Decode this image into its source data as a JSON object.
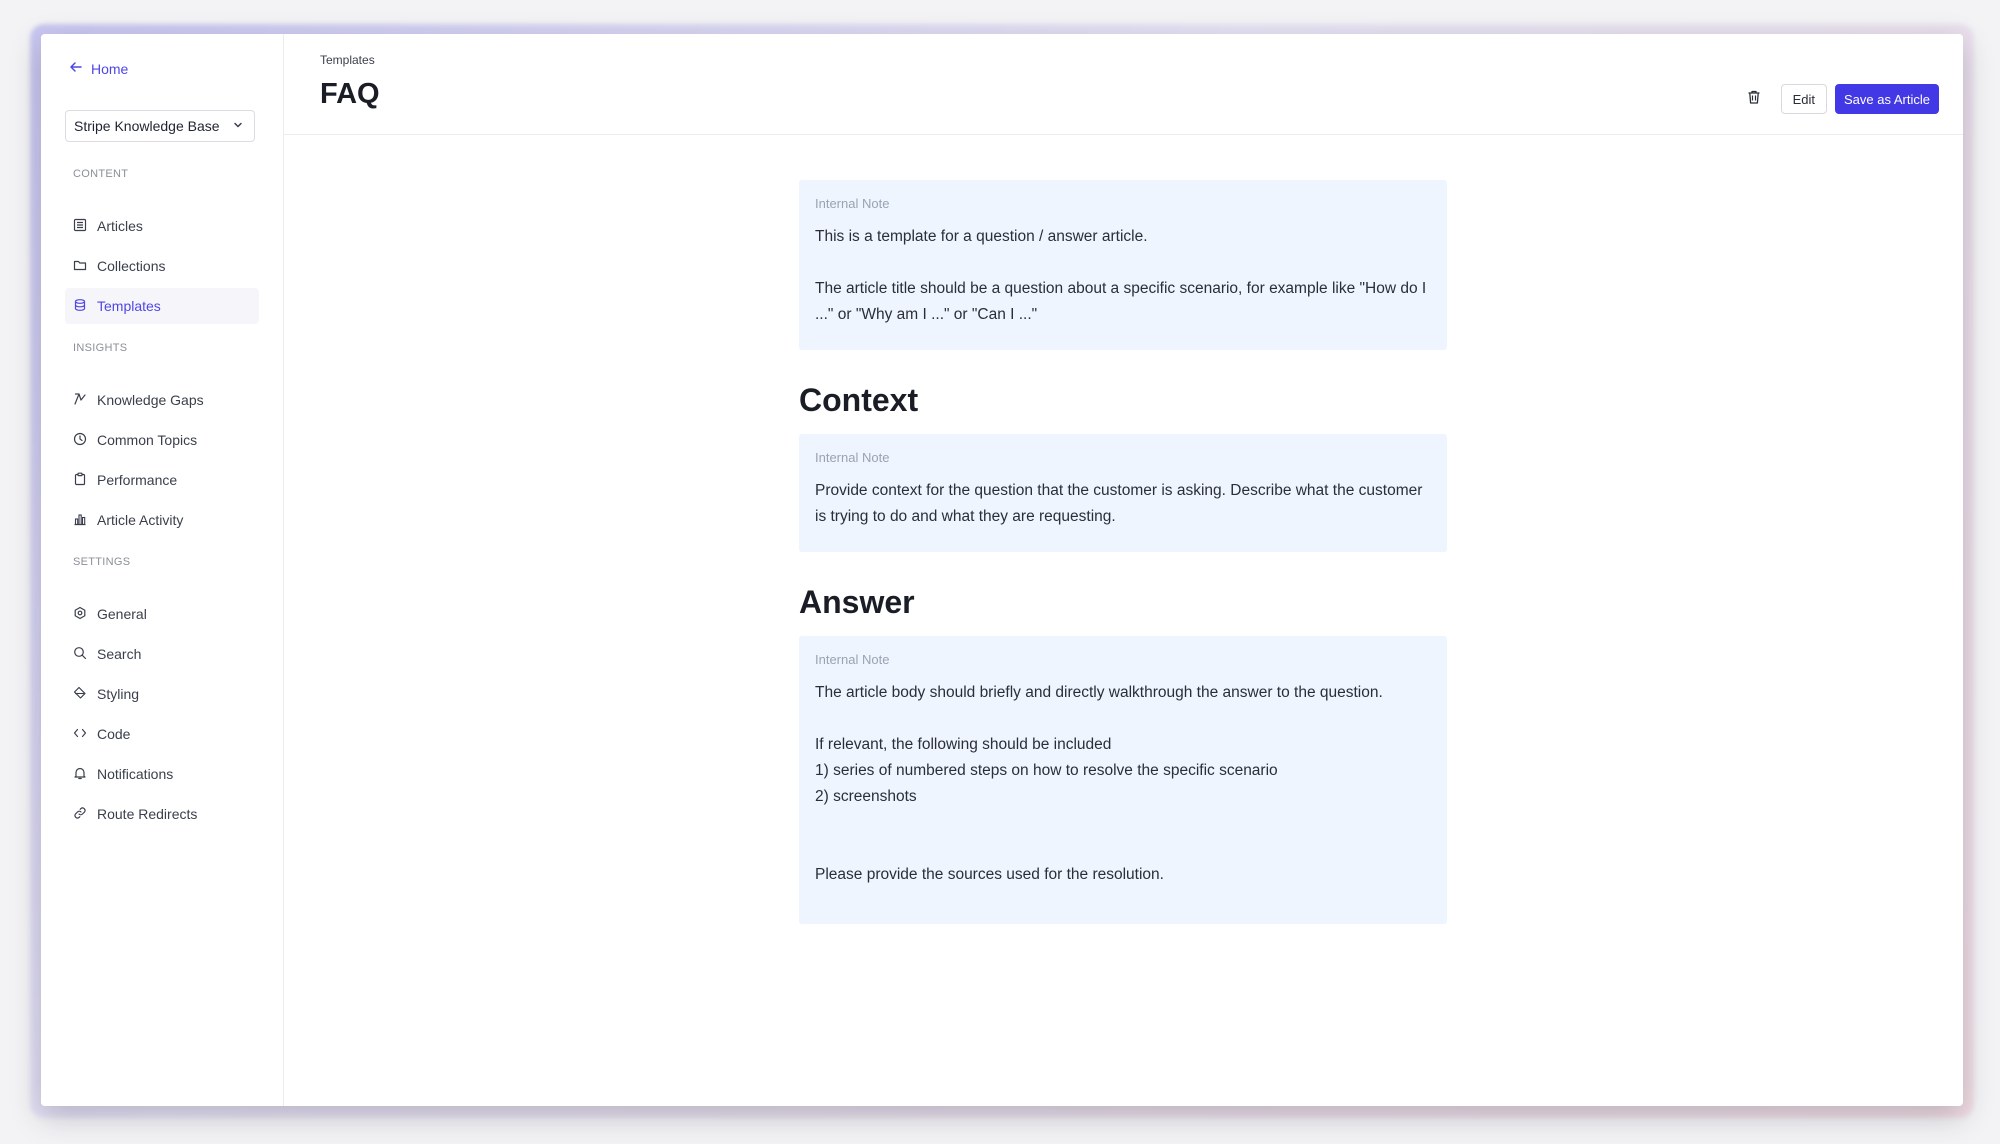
{
  "sidebar": {
    "home_label": "Home",
    "kb_select": "Stripe Knowledge Base",
    "sections": {
      "content": "CONTENT",
      "insights": "INSIGHTS",
      "settings": "SETTINGS"
    },
    "content_items": [
      {
        "label": "Articles",
        "icon": "articles-icon"
      },
      {
        "label": "Collections",
        "icon": "folder-icon"
      },
      {
        "label": "Templates",
        "icon": "database-icon",
        "active": true
      }
    ],
    "insights_items": [
      {
        "label": "Knowledge Gaps",
        "icon": "gap-icon"
      },
      {
        "label": "Common Topics",
        "icon": "clock-icon"
      },
      {
        "label": "Performance",
        "icon": "clipboard-icon"
      },
      {
        "label": "Article Activity",
        "icon": "bar-chart-icon"
      }
    ],
    "settings_items": [
      {
        "label": "General",
        "icon": "gear-icon"
      },
      {
        "label": "Search",
        "icon": "search-icon"
      },
      {
        "label": "Styling",
        "icon": "paint-icon"
      },
      {
        "label": "Code",
        "icon": "code-icon"
      },
      {
        "label": "Notifications",
        "icon": "bell-icon"
      },
      {
        "label": "Route Redirects",
        "icon": "link-icon"
      }
    ]
  },
  "header": {
    "breadcrumb": "Templates",
    "title": "FAQ",
    "edit_label": "Edit",
    "save_label": "Save as Article"
  },
  "main": {
    "intro_note": {
      "label": "Internal Note",
      "text": "This is a template for a question / answer article.\n\nThe article title should be a question about a specific scenario, for example like \"How do I ...\" or \"Why am I ...\" or \"Can I ...\""
    },
    "context_heading": "Context",
    "context_note": {
      "label": "Internal Note",
      "text": "Provide context for the question that the customer is asking. Describe what the customer is trying to do and what they are requesting."
    },
    "answer_heading": "Answer",
    "answer_note": {
      "label": "Internal Note",
      "text": "The article body should briefly and directly walkthrough the answer to the question.\n\nIf relevant, the following should be included\n1) series of numbered steps on how to resolve the specific scenario\n2) screenshots\n\n\nPlease provide the sources used for the resolution."
    }
  },
  "colors": {
    "accent": "#4f46e5",
    "primary_button": "#4338e6",
    "note_background": "#eef5fe"
  }
}
